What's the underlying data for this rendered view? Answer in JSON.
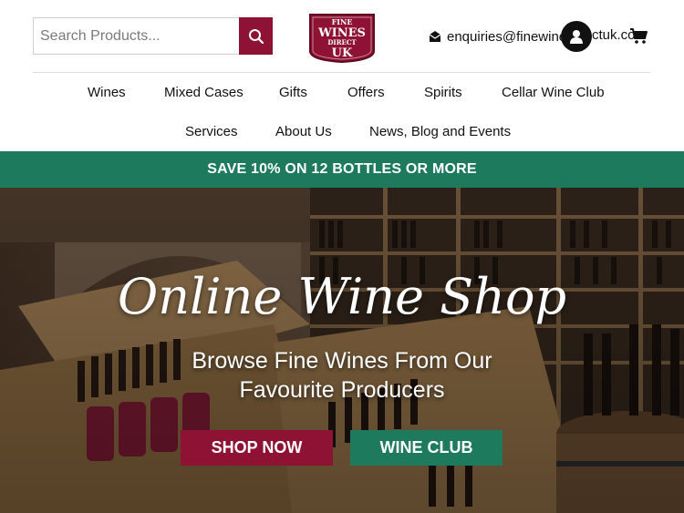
{
  "header": {
    "search_placeholder": "Search Products...",
    "logo_lines": [
      "FINE",
      "WINES",
      "DIRECT",
      "UK"
    ],
    "email_text": "enquiries@finewines",
    "email_tail": "ctuk.com"
  },
  "nav": {
    "items": [
      "Wines",
      "Mixed Cases",
      "Gifts",
      "Offers",
      "Spirits",
      "Cellar Wine Club",
      "Services",
      "About Us",
      "News, Blog and Events"
    ]
  },
  "promo": {
    "text": "SAVE 10% ON 12 BOTTLES OR MORE"
  },
  "hero": {
    "title": "Online Wine Shop",
    "subtitle_line1": "Browse Fine Wines From Our",
    "subtitle_line2": "Favourite Producers",
    "shop_button": "SHOP NOW",
    "club_button": "WINE CLUB"
  },
  "colors": {
    "brand_red": "#8e1233",
    "brand_green": "#1d7a5c"
  },
  "icons": [
    "search-icon",
    "envelope-icon",
    "account-icon",
    "cart-icon"
  ]
}
